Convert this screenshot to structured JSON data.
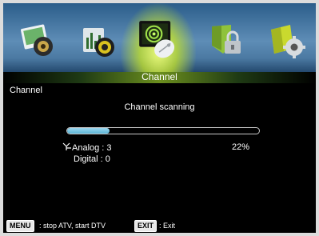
{
  "menu": {
    "tabs": [
      {
        "icon": "picture-icon"
      },
      {
        "icon": "sound-icon"
      },
      {
        "icon": "channel-icon",
        "active": true
      },
      {
        "icon": "lock-icon"
      },
      {
        "icon": "setup-icon"
      }
    ],
    "active_tab_label": "Channel"
  },
  "section_label": "Channel",
  "scan": {
    "title": "Channel scanning",
    "progress_percent": 22,
    "progress_label": "22%",
    "analog_label": "Analog : 3",
    "digital_label": "Digital : 0"
  },
  "footer": {
    "menu_key": "MENU",
    "menu_action": ": stop ATV, start DTV",
    "exit_key": "EXIT",
    "exit_action": ": Exit"
  },
  "colors": {
    "accent": "#a4c639",
    "progress": "#7cc6e3"
  }
}
